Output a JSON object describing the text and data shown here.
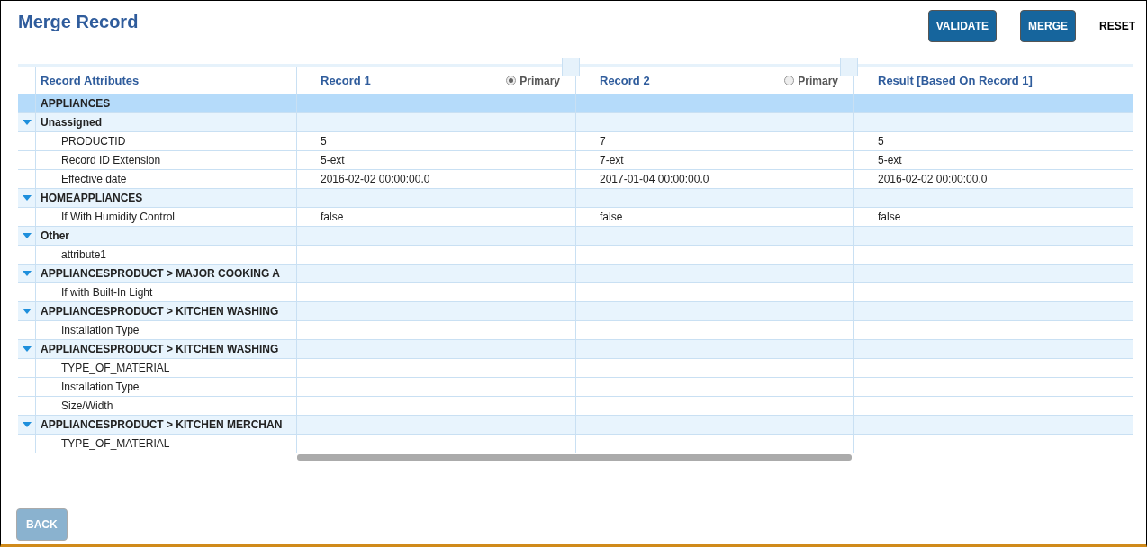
{
  "page": {
    "title": "Merge Record"
  },
  "actions": [
    {
      "label": "VALIDATE",
      "kind": "primary"
    },
    {
      "label": "MERGE",
      "kind": "primary"
    },
    {
      "label": "RESET",
      "kind": "link"
    }
  ],
  "table": {
    "columns": [
      {
        "label": "Record Attributes",
        "kind": "attribute"
      },
      {
        "label": "Record 1",
        "kind": "record",
        "primary": {
          "label": "Primary",
          "selected": true
        }
      },
      {
        "label": "Record 2",
        "kind": "record",
        "primary": {
          "label": "Primary",
          "selected": false
        }
      },
      {
        "label": "Result [Based On Record 1]",
        "kind": "result"
      }
    ],
    "rows": [
      {
        "kind": "category",
        "label": "APPLIANCES"
      },
      {
        "kind": "group",
        "label": "Unassigned",
        "expanded": true
      },
      {
        "kind": "attribute",
        "label": "PRODUCTID",
        "values": [
          "5",
          "7",
          "5"
        ]
      },
      {
        "kind": "attribute",
        "label": "Record ID Extension",
        "values": [
          "5-ext",
          "7-ext",
          "5-ext"
        ]
      },
      {
        "kind": "attribute",
        "label": "Effective date",
        "values": [
          "2016-02-02 00:00:00.0",
          "2017-01-04 00:00:00.0",
          "2016-02-02 00:00:00.0"
        ]
      },
      {
        "kind": "group",
        "label": "HOMEAPPLIANCES",
        "expanded": true
      },
      {
        "kind": "attribute",
        "label": "If With Humidity Control",
        "values": [
          "false",
          "false",
          "false"
        ]
      },
      {
        "kind": "group",
        "label": "Other",
        "expanded": true
      },
      {
        "kind": "attribute",
        "label": "attribute1"
      },
      {
        "kind": "group",
        "label": "APPLIANCESPRODUCT > MAJOR COOKING A",
        "expanded": true
      },
      {
        "kind": "attribute",
        "label": "If with Built-In Light"
      },
      {
        "kind": "group",
        "label": "APPLIANCESPRODUCT > KITCHEN WASHING",
        "expanded": true
      },
      {
        "kind": "attribute",
        "label": "Installation Type"
      },
      {
        "kind": "group",
        "label": "APPLIANCESPRODUCT > KITCHEN WASHING",
        "expanded": true
      },
      {
        "kind": "attribute",
        "label": "TYPE_OF_MATERIAL"
      },
      {
        "kind": "attribute",
        "label": "Installation Type"
      },
      {
        "kind": "attribute",
        "label": "Size/Width"
      },
      {
        "kind": "group",
        "label": "APPLIANCESPRODUCT > KITCHEN MERCHAN",
        "expanded": true
      },
      {
        "kind": "attribute",
        "label": "TYPE_OF_MATERIAL"
      }
    ]
  },
  "footer": {
    "back": {
      "label": "BACK",
      "disabled": true
    }
  }
}
